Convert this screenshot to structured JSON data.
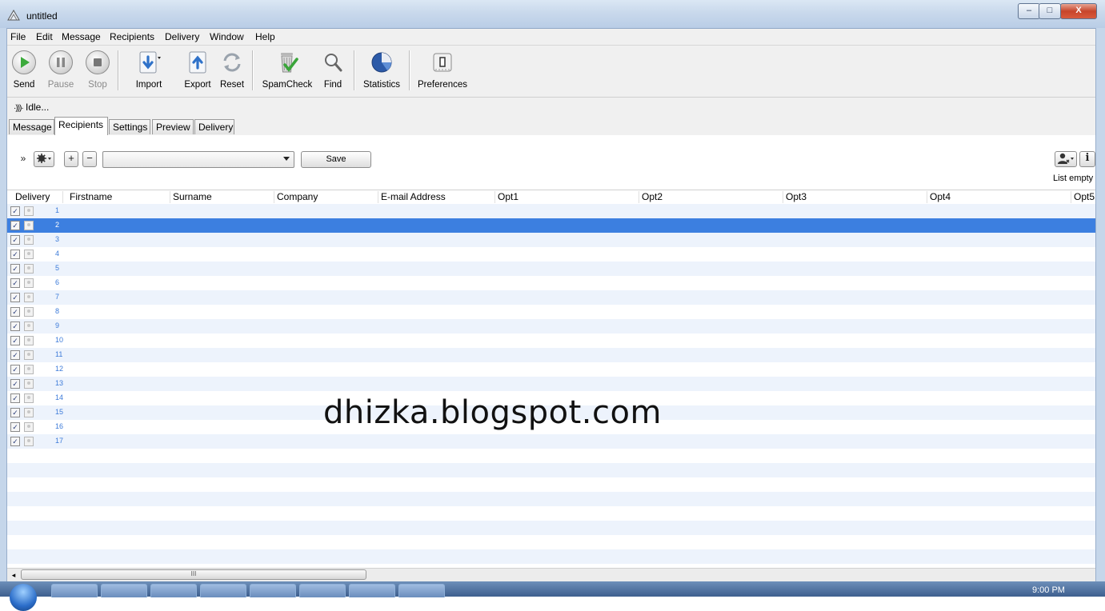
{
  "window": {
    "title": "untitled",
    "min": "–",
    "max": "□",
    "close": "X"
  },
  "menu": [
    "File",
    "Edit",
    "Message",
    "Recipients",
    "Delivery",
    "Window",
    "Help"
  ],
  "toolbar": {
    "send": "Send",
    "pause": "Pause",
    "stop": "Stop",
    "import": "Import",
    "export": "Export",
    "reset": "Reset",
    "spamcheck": "SpamCheck",
    "find": "Find",
    "statistics": "Statistics",
    "preferences": "Preferences"
  },
  "status": {
    "text": "Idle..."
  },
  "tabs": [
    {
      "label": "Message",
      "active": false
    },
    {
      "label": "Recipients",
      "active": true
    },
    {
      "label": "Settings",
      "active": false
    },
    {
      "label": "Preview",
      "active": false
    },
    {
      "label": "Delivery",
      "active": false
    }
  ],
  "recipients": {
    "collapse": "»",
    "plus": "+",
    "minus": "−",
    "list_selected": "",
    "save_label": "Save",
    "list_status": "List empty",
    "info_glyph": "i"
  },
  "table": {
    "columns": [
      "Delivery",
      "Firstname",
      "Surname",
      "Company",
      "E-mail Address",
      "Opt1",
      "Opt2",
      "Opt3",
      "Opt4",
      "Opt5"
    ],
    "row_numbers": [
      "1",
      "2",
      "3",
      "4",
      "5",
      "6",
      "7",
      "8",
      "9",
      "10",
      "11",
      "12",
      "13",
      "14",
      "15",
      "16",
      "17"
    ],
    "selected_row": "2",
    "checkmark": "✓"
  },
  "watermark": "dhizka.blogspot.com",
  "scrollbar": {
    "left_arrow": "◂",
    "grip": "III"
  },
  "taskbar": {
    "clock": "9:00 PM"
  },
  "colors": {
    "selection": "#3c7fe0",
    "row_alt": "#edf3fc",
    "row_number": "#3d7bd9"
  }
}
